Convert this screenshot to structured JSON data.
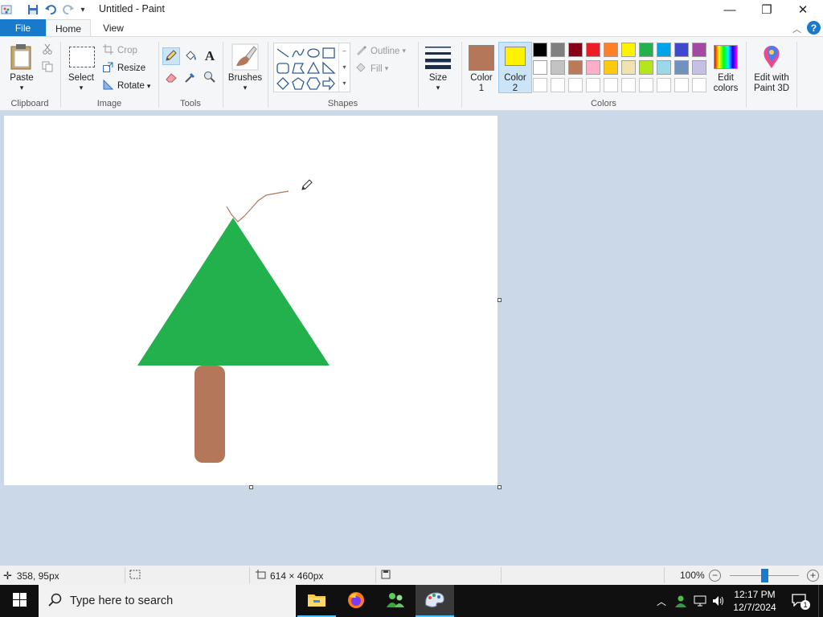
{
  "window": {
    "title": "Untitled - Paint",
    "minimize_glyph": "—",
    "maximize_glyph": "❐",
    "close_glyph": "✕"
  },
  "tabs": {
    "file": "File",
    "home": "Home",
    "view": "View"
  },
  "ribbon": {
    "clipboard": {
      "group": "Clipboard",
      "paste": "Paste"
    },
    "image": {
      "group": "Image",
      "select": "Select",
      "crop": "Crop",
      "resize": "Resize",
      "rotate": "Rotate"
    },
    "tools": {
      "group": "Tools"
    },
    "brushes": {
      "label": "Brushes"
    },
    "shapes": {
      "group": "Shapes",
      "outline": "Outline",
      "fill": "Fill"
    },
    "size": {
      "label": "Size"
    },
    "colors": {
      "group": "Colors",
      "color1_label": "Color\n1",
      "color2_label": "Color\n2",
      "color1_value": "#b5775a",
      "color2_value": "#fff200",
      "edit_colors": "Edit\ncolors",
      "edit_paint3d": "Edit with\nPaint 3D",
      "palette_row1": [
        "#000000",
        "#7f7f7f",
        "#880015",
        "#ed1c24",
        "#ff7f27",
        "#fff200",
        "#22b14c",
        "#00a2e8",
        "#3f48cc",
        "#a349a4"
      ],
      "palette_row2": [
        "#ffffff",
        "#c3c3c3",
        "#b97a57",
        "#ffaec9",
        "#ffc90e",
        "#efe4b0",
        "#b5e61d",
        "#99d9ea",
        "#7092be",
        "#c8bfe7"
      ]
    }
  },
  "canvas": {
    "tree_top_color": "#22b14c",
    "trunk_color": "#b5775a",
    "line_color": "#b5775a"
  },
  "status": {
    "cursor_pos": "358, 95px",
    "canvas_size": "614 × 460px",
    "zoom": "100%",
    "zoom_level": 1.0
  },
  "taskbar": {
    "search_placeholder": "Type here to search",
    "time": "12:17 PM",
    "date": "12/7/2024",
    "notification_count": "1"
  }
}
